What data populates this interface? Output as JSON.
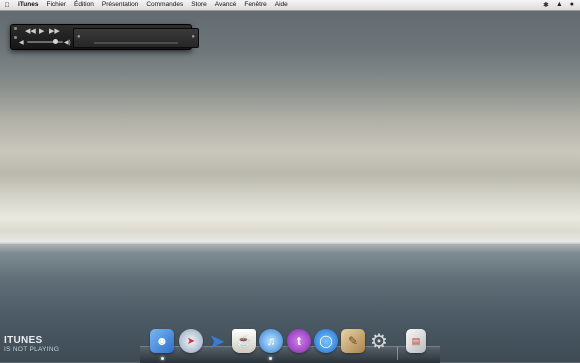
{
  "menubar": {
    "apple": "",
    "items": [
      "iTunes",
      "Fichier",
      "Édition",
      "Présentation",
      "Commandes",
      "Store",
      "Avancé",
      "Fenêtre",
      "Aide"
    ]
  },
  "mini_player": {
    "line1": "",
    "line2": ""
  },
  "desktop_label": {
    "title": "ITUNES",
    "status": "IS NOT PLAYING"
  },
  "dock": {
    "icons": [
      "finder-icon",
      "safari-icon",
      "mail-send-icon",
      "coffee-mug-icon",
      "itunes-icon",
      "twitter-icon",
      "messages-icon",
      "notes-icon",
      "settings-gear-icon",
      "stacks-icon"
    ],
    "colors": {
      "finder": "#4f8fd8",
      "safari": "#cfd8e6",
      "mail": "#3b7ad6",
      "coffee": "#f1efe9",
      "itunes": "#5aa6ea",
      "twitter": "#a54bd1",
      "messages": "#2a8cf0",
      "notes": "#c9a770",
      "gear": "#bdbdbd",
      "stack": "#e2e2e2"
    }
  }
}
